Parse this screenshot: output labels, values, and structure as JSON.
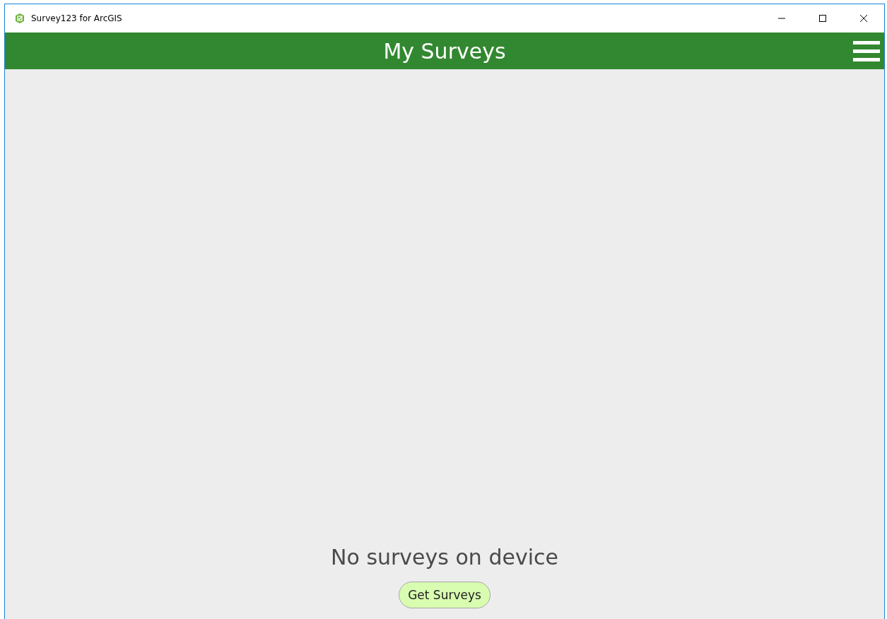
{
  "window": {
    "title": "Survey123 for ArcGIS"
  },
  "header": {
    "title": "My Surveys"
  },
  "content": {
    "message": "No surveys on device",
    "button": "Get Surveys"
  }
}
